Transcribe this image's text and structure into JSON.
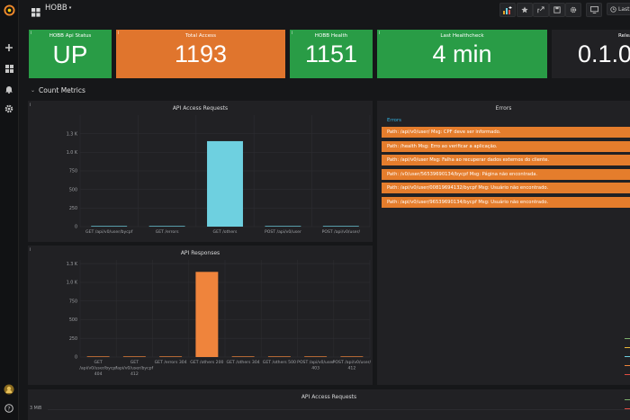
{
  "header": {
    "dashboard_title": "HOBB",
    "time_picker_label": "Last"
  },
  "stats": [
    {
      "title": "HOBB Api Status",
      "value": "UP",
      "color": "#299c46"
    },
    {
      "title": "Total Access",
      "value": "1193",
      "color": "#e0752d"
    },
    {
      "title": "HOBB Health",
      "value": "1151",
      "color": "#299c46"
    },
    {
      "title": "Last Healthcheck",
      "value": "4 min",
      "color": "#299c46"
    },
    {
      "title": "Relea",
      "value": "0.1.0",
      "color": "#212124"
    }
  ],
  "row": {
    "title": "Count Metrics"
  },
  "chart_data": [
    {
      "type": "bar",
      "title": "API Access Requests",
      "categories": [
        "GET /api/v0/user/bycpf",
        "GET /errors",
        "GET /others",
        "POST /api/v0/user",
        "POST /api/v0/user/"
      ],
      "values": [
        8,
        5,
        1150,
        0,
        0
      ],
      "ylim": [
        0,
        1500
      ],
      "yticks": [
        "0",
        "250",
        "500",
        "750",
        "1.0 K",
        "1.3 K"
      ],
      "ytick_values": [
        0,
        250,
        500,
        750,
        1000,
        1250
      ],
      "color": "#6ed0e0"
    },
    {
      "type": "bar",
      "title": "API Responses",
      "categories": [
        "GET /api/v0/user/bycpf 404",
        "GET /api/v0/user/bycpf 412",
        "GET /errors 304",
        "GET /others 200",
        "GET /others 304",
        "GET /others 500",
        "POST /api/v0/user 403",
        "POST /api/v0/user/ 412"
      ],
      "xtick_lines": [
        [
          "GET",
          "/api/v0/user/bycpf",
          "404"
        ],
        [
          "GET",
          "/api/v0/user/bycpf",
          "412"
        ],
        [
          "GET /errors 304"
        ],
        [
          "GET /others 200"
        ],
        [
          "GET /others 304"
        ],
        [
          "GET /others 500"
        ],
        [
          "POST /api/v0/user",
          "403"
        ],
        [
          "POST /api/v0/user/",
          "412"
        ]
      ],
      "values": [
        4,
        4,
        0,
        1140,
        5,
        2,
        0,
        0
      ],
      "ylim": [
        0,
        1300
      ],
      "yticks": [
        "0",
        "250",
        "500",
        "750",
        "1.0 K",
        "1.3 K"
      ],
      "ytick_values": [
        0,
        250,
        500,
        750,
        1000,
        1250
      ],
      "color": "#ef843c"
    }
  ],
  "errors_panel": {
    "title": "Errors",
    "column": "Errors",
    "rows": [
      "Path: /api/v0/user/ Msg: CPF deve ser informado.",
      "Path: /health Msg: Erro ao verificar a aplicação.",
      "Path: /api/v0/user Msg: Falha ao recuperar dados externos do cliente.",
      "Path: /v0/user/56539690134/bycpf Msg: Página não encontrada.",
      "Path: /api/v0/user/00819694132/bycpf Msg: Usuário não encontrado.",
      "Path: /api/v0/user/96539690134/bycpf Msg: Usuário não encontrado."
    ]
  },
  "bottom_panel": {
    "title": "API Access Requests",
    "ytick": "3 MiB"
  },
  "colors": {
    "background": "#161719",
    "panel": "#212124",
    "green": "#299c46",
    "orange": "#e0752d",
    "cyan": "#6ed0e0",
    "error_row": "#e57d2c"
  },
  "icons": [
    "grafana-logo-icon",
    "plus-icon",
    "dashboards-icon",
    "bell-icon",
    "gear-icon",
    "avatar-icon",
    "help-icon",
    "apps-icon",
    "chevron-down-icon",
    "add-panel-icon",
    "star-icon",
    "share-icon",
    "save-icon",
    "cog-icon",
    "monitor-icon",
    "clock-icon"
  ]
}
